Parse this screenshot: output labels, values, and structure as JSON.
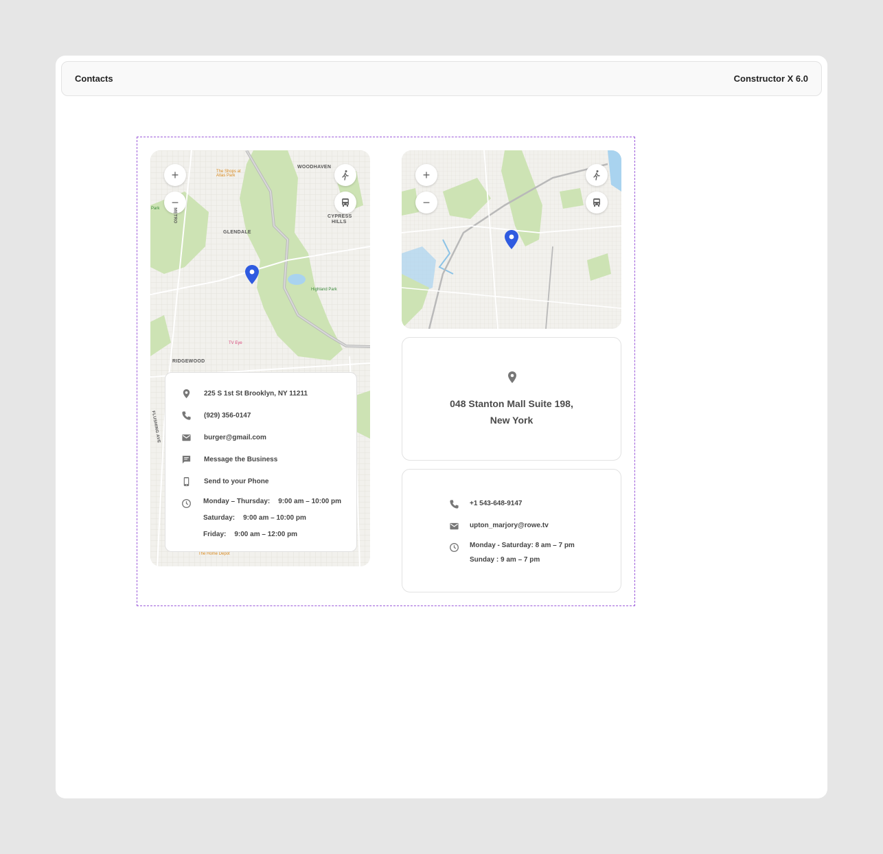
{
  "topbar": {
    "title": "Contacts",
    "version": "Constructor X 6.0"
  },
  "map_left": {
    "zoom_in": "+",
    "zoom_out": "−",
    "labels": [
      "WOODHAVEN",
      "GLENDALE",
      "CYPRESS",
      "HILLS",
      "RIDGEWOOD",
      "METRO",
      "FLUSHING AVE"
    ],
    "pois": [
      "The Shops at",
      "Atlas Park",
      "Highland Park",
      "TV Eye",
      "The Home Depot",
      "Park"
    ]
  },
  "map_right": {
    "zoom_in": "+",
    "zoom_out": "−"
  },
  "info": {
    "address": "225 S 1st St Brooklyn, NY 11211",
    "phone": "(929) 356-0147",
    "email": "burger@gmail.com",
    "message": "Message the Business",
    "send": "Send to your Phone",
    "hours": [
      {
        "day": "Monday – Thursday:",
        "time": "9:00 am – 10:00 pm"
      },
      {
        "day": "Saturday:",
        "time": "9:00 am – 10:00 pm"
      },
      {
        "day": "Friday:",
        "time": "9:00 am – 12:00 pm"
      }
    ]
  },
  "address_card": {
    "line1": "048 Stanton Mall Suite 198,",
    "line2": "New York"
  },
  "contact_card": {
    "phone": "+1 543-648-9147",
    "email": "upton_marjory@rowe.tv",
    "hours1": "Monday - Saturday: 8 am – 7 pm",
    "hours2": "Sunday : 9 am – 7 pm"
  },
  "colors": {
    "accent": "#2f5be0",
    "selection": "#9b59d9",
    "park": "#cde3b4",
    "road": "#b9b9b9",
    "water": "#a9d3ef"
  }
}
